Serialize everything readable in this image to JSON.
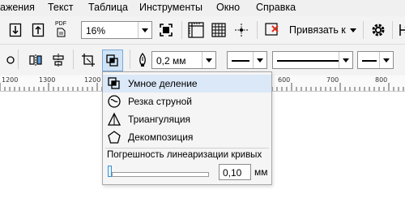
{
  "menubar": {
    "items": [
      "ажения",
      "Текст",
      "Таблица",
      "Инструменты",
      "Окно",
      "Справка"
    ]
  },
  "toolbar1": {
    "zoom_value": "16%",
    "pdf_label": "PDF",
    "snap_label": "Привязать к"
  },
  "toolbar2": {
    "outline_width": "0,2 мм"
  },
  "ruler": {
    "labels": [
      "1200",
      "1300",
      "1200",
      "600",
      "700",
      "800"
    ]
  },
  "popup": {
    "items": [
      {
        "label": "Умное деление",
        "icon": "smart-divide-icon"
      },
      {
        "label": "Резка струной",
        "icon": "string-cut-icon"
      },
      {
        "label": "Триангуляция",
        "icon": "triangulation-icon"
      },
      {
        "label": "Декомпозиция",
        "icon": "decomposition-icon"
      }
    ],
    "tolerance_title": "Погрешность линеаризации кривых",
    "tolerance_value": "0,10",
    "tolerance_unit": "мм"
  },
  "colors": {
    "accent": "#3a8fd6",
    "toolbar_bg": "#f3f3f3",
    "popup_bg": "#f5f5f5"
  }
}
